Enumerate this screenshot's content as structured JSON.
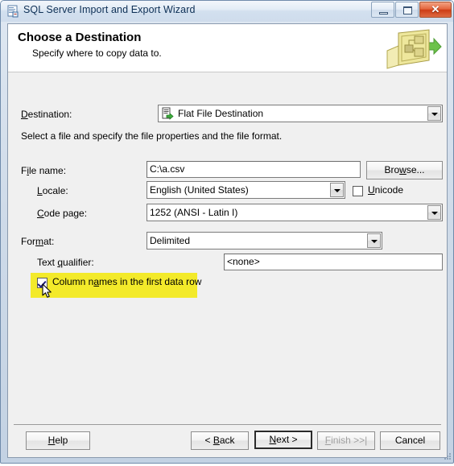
{
  "window": {
    "title": "SQL Server Import and Export Wizard",
    "title_icon": "wizard-document-icon",
    "controls": {
      "minimize_label": "–",
      "maximize_label": "□",
      "close_label": "✕"
    }
  },
  "header": {
    "title": "Choose a Destination",
    "subtitle": "Specify where to copy data to.",
    "icon": "ssis-package-arrow-icon"
  },
  "form": {
    "destination": {
      "label": "Destination:",
      "label_accel": "D",
      "value": "Flat File Destination",
      "icon": "flat-file-destination-icon"
    },
    "description": "Select a file and specify the file properties and the file format.",
    "file_name": {
      "label": "File name:",
      "label_accel": "l",
      "value": "C:\\a.csv"
    },
    "browse": {
      "label": "Browse...",
      "label_accel": "w"
    },
    "locale": {
      "label": "Locale:",
      "label_accel": "L",
      "value": "English (United States)"
    },
    "unicode": {
      "label": "Unicode",
      "label_accel": "U",
      "checked": false
    },
    "code_page": {
      "label": "Code page:",
      "label_accel": "C",
      "value": "1252  (ANSI - Latin I)"
    },
    "format": {
      "label": "Format:",
      "label_accel": "m",
      "value": "Delimited"
    },
    "text_qualifier": {
      "label": "Text qualifier:",
      "label_accel": "q",
      "value": "<none>"
    },
    "column_names_first_row": {
      "label": "Column names in the first data row",
      "label_accel": "a",
      "checked": true,
      "highlight_color": "#f3ea2a"
    }
  },
  "footer": {
    "help": {
      "label": "Help",
      "accel": "H"
    },
    "back": {
      "label": "< Back",
      "accel": "B"
    },
    "next": {
      "label": "Next >",
      "accel": "N",
      "is_default": true
    },
    "finish": {
      "label": "Finish >>|",
      "accel": "F",
      "disabled": true
    },
    "cancel": {
      "label": "Cancel"
    }
  }
}
